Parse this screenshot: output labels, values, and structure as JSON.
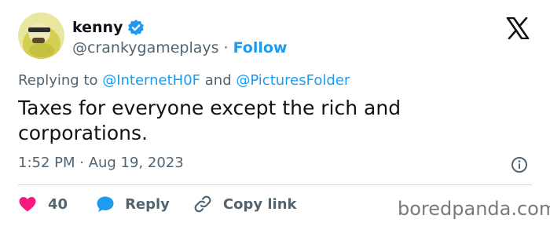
{
  "author": {
    "name": "kenny",
    "handle": "@crankygameplays",
    "separator": "·",
    "follow_label": "Follow",
    "verified_icon": "verified-badge-icon"
  },
  "reply_context": {
    "prefix": "Replying to ",
    "mention1": "@InternetH0F",
    "conjunction": " and ",
    "mention2": "@PicturesFolder"
  },
  "tweet": {
    "text": "Taxes for everyone except the rich and corporations.",
    "timestamp": "1:52 PM · Aug 19, 2023"
  },
  "actions": {
    "likes_count": "40",
    "reply_label": "Reply",
    "copy_label": "Copy link"
  },
  "watermark": "boredpanda.com",
  "colors": {
    "accent": "#1d9bf0",
    "like": "#f91880",
    "text": "#0f1419",
    "muted": "#536471"
  }
}
